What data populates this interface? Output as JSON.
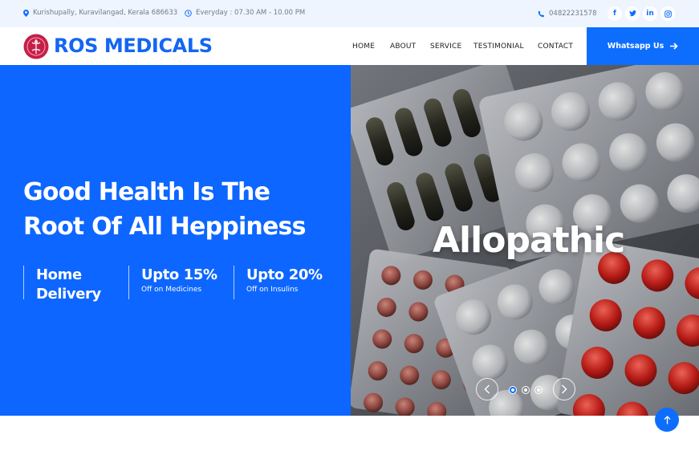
{
  "topbar": {
    "address": "Kurishupally, Kuravilangad, Kerala 686633",
    "hours": "Everyday : 07.30 AM - 10.00 PM",
    "phone": "04822231578",
    "socials": [
      {
        "icon": "facebook-icon",
        "glyph": "f"
      },
      {
        "icon": "twitter-icon",
        "glyph": "t"
      },
      {
        "icon": "linkedin-icon",
        "glyph": "in"
      },
      {
        "icon": "instagram-icon",
        "glyph": "◎"
      }
    ]
  },
  "navbar": {
    "brand": "ROS MEDICALS",
    "links": [
      "HOME",
      "ABOUT",
      "SERVICE",
      "TESTIMONIAL",
      "CONTACT"
    ],
    "cta": "Whatsapp Us",
    "cta_icon": "arrow-right-icon"
  },
  "hero": {
    "title_line1": "Good Health Is The",
    "title_line2": "Root Of All Heppiness",
    "features": [
      {
        "title_line1": "Home",
        "title_line2": "Delivery",
        "subtitle": ""
      },
      {
        "title_line1": "Upto 15%",
        "title_line2": "",
        "subtitle": "Off on Medicines"
      },
      {
        "title_line1": "Upto 20%",
        "title_line2": "",
        "subtitle": "Off on Insulins"
      }
    ],
    "slide_caption": "Allopathic",
    "carousel": {
      "slides": 3,
      "active_index": 0
    }
  },
  "colors": {
    "primary": "#0d6efd",
    "hero_bg": "#0d66ff",
    "topbar_bg": "#eff5ff",
    "brand_text": "#1466f2"
  }
}
